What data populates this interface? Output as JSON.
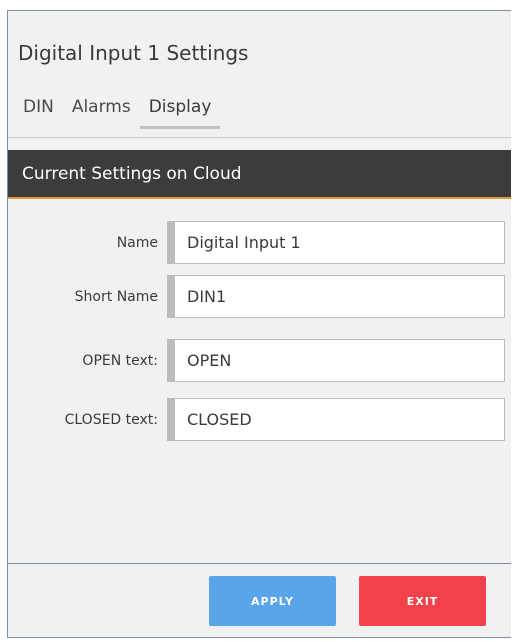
{
  "dialog": {
    "title": "Digital Input 1 Settings"
  },
  "tabs": [
    {
      "label": "DIN"
    },
    {
      "label": "Alarms"
    },
    {
      "label": "Display"
    }
  ],
  "active_tab": "Display",
  "section": {
    "header": "Current Settings on Cloud"
  },
  "form": {
    "name": {
      "label": "Name",
      "value": "Digital Input 1"
    },
    "short_name": {
      "label": "Short Name",
      "value": "DIN1"
    },
    "open_text": {
      "label": "OPEN text:",
      "value": "OPEN"
    },
    "closed_text": {
      "label": "CLOSED text:",
      "value": "CLOSED"
    }
  },
  "buttons": {
    "apply": "APPLY",
    "exit": "EXIT"
  },
  "colors": {
    "header_bg": "#3c3c3b",
    "header_accent": "#e09a3a",
    "apply_bg": "#5aa4ea",
    "exit_bg": "#f2414b"
  }
}
